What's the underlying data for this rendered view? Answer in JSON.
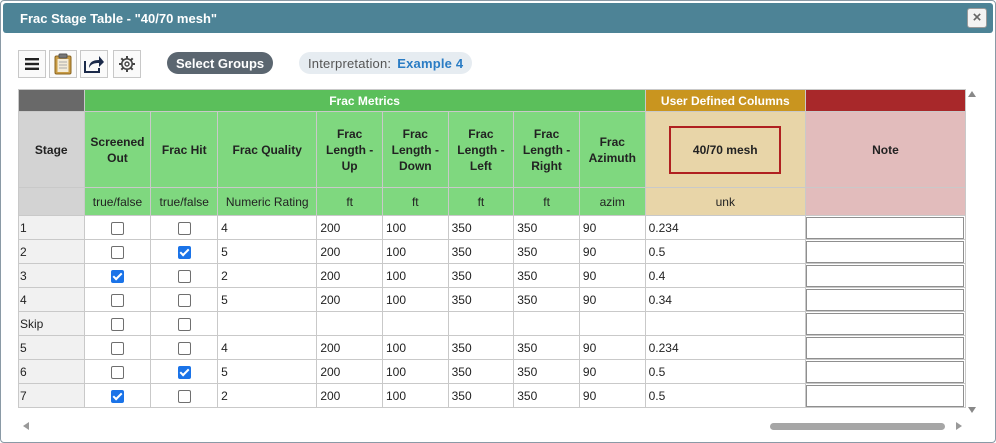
{
  "window": {
    "title": "Frac Stage Table - \"40/70 mesh\"",
    "close_label": "×"
  },
  "toolbar": {
    "buttons": [
      {
        "icon": "menu-icon"
      },
      {
        "icon": "clipboard-icon"
      },
      {
        "icon": "export-icon"
      },
      {
        "icon": "gear-icon"
      }
    ],
    "select_groups_label": "Select Groups",
    "interpretation_label": "Interpretation:",
    "interpretation_value": "Example 4"
  },
  "grid": {
    "groups": {
      "metrics": "Frac Metrics",
      "user_defined": "User Defined Columns"
    },
    "headers": {
      "stage": "Stage",
      "screened_out": "Screened Out",
      "frac_hit": "Frac Hit",
      "frac_quality": "Frac Quality",
      "length_up": "Frac Length - Up",
      "length_down": "Frac Length - Down",
      "length_left": "Frac Length - Left",
      "length_right": "Frac Length - Right",
      "azimuth": "Frac Azimuth",
      "mesh": "40/70 mesh",
      "note": "Note"
    },
    "units": {
      "stage": "",
      "screened_out": "true/false",
      "frac_hit": "true/false",
      "frac_quality": "Numeric Rating",
      "length_up": "ft",
      "length_down": "ft",
      "length_left": "ft",
      "length_right": "ft",
      "azimuth": "azim",
      "mesh": "unk",
      "note": ""
    },
    "rows": [
      {
        "stage": "1",
        "screened": false,
        "hit": false,
        "quality": "4",
        "up": "200",
        "down": "100",
        "left": "350",
        "right": "350",
        "azimuth": "90",
        "mesh": "0.234"
      },
      {
        "stage": "2",
        "screened": false,
        "hit": true,
        "quality": "5",
        "up": "200",
        "down": "100",
        "left": "350",
        "right": "350",
        "azimuth": "90",
        "mesh": "0.5"
      },
      {
        "stage": "3",
        "screened": true,
        "hit": false,
        "quality": "2",
        "up": "200",
        "down": "100",
        "left": "350",
        "right": "350",
        "azimuth": "90",
        "mesh": "0.4"
      },
      {
        "stage": "4",
        "screened": false,
        "hit": false,
        "quality": "5",
        "up": "200",
        "down": "100",
        "left": "350",
        "right": "350",
        "azimuth": "90",
        "mesh": "0.34"
      },
      {
        "stage": "Skip",
        "screened": false,
        "hit": false,
        "quality": "",
        "up": "",
        "down": "",
        "left": "",
        "right": "",
        "azimuth": "",
        "mesh": ""
      },
      {
        "stage": "5",
        "screened": false,
        "hit": false,
        "quality": "4",
        "up": "200",
        "down": "100",
        "left": "350",
        "right": "350",
        "azimuth": "90",
        "mesh": "0.234"
      },
      {
        "stage": "6",
        "screened": false,
        "hit": true,
        "quality": "5",
        "up": "200",
        "down": "100",
        "left": "350",
        "right": "350",
        "azimuth": "90",
        "mesh": "0.5"
      },
      {
        "stage": "7",
        "screened": true,
        "hit": false,
        "quality": "2",
        "up": "200",
        "down": "100",
        "left": "350",
        "right": "350",
        "azimuth": "90",
        "mesh": "0.5"
      }
    ]
  }
}
